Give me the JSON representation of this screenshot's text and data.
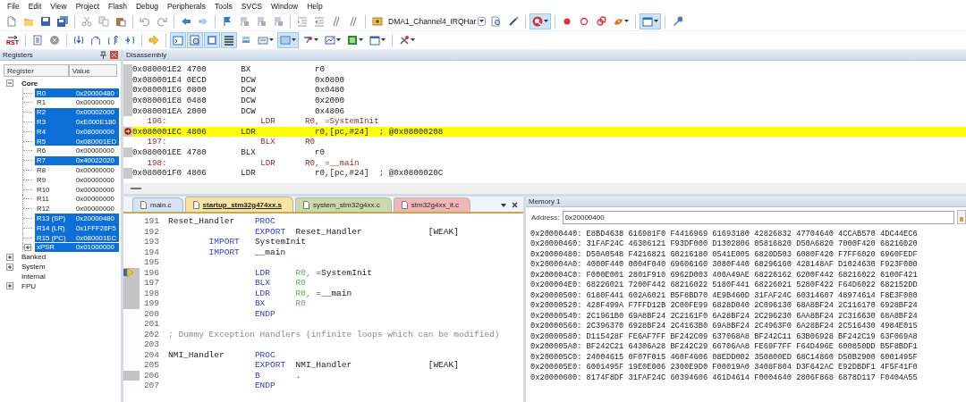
{
  "menu": [
    "File",
    "Edit",
    "View",
    "Project",
    "Flash",
    "Debug",
    "Peripherals",
    "Tools",
    "SVCS",
    "Window",
    "Help"
  ],
  "toolbar": {
    "target": "DMA1_Channel4_IRQHar",
    "debug_on": true,
    "window_layout_on": true
  },
  "debug_toolbar": {
    "reset_label": "RST",
    "view_buttons": [
      {
        "on": true
      },
      {
        "on": true
      },
      {
        "on": true
      },
      {
        "on": true
      },
      {
        "on": false
      },
      {
        "on": false
      },
      {
        "on": true
      },
      {
        "on": false
      },
      {
        "on": false
      },
      {
        "on": false
      },
      {
        "on": false
      }
    ]
  },
  "registers": {
    "title": "Registers",
    "columns": [
      "Register",
      "Value"
    ],
    "tree": [
      {
        "name": "Core",
        "expanded": true,
        "children": [
          {
            "name": "R0",
            "value": "0x20000480",
            "selected": true
          },
          {
            "name": "R1",
            "value": "0x00000000",
            "selected": false
          },
          {
            "name": "R2",
            "value": "0x00002000",
            "selected": true
          },
          {
            "name": "R3",
            "value": "0xE000E180",
            "selected": true
          },
          {
            "name": "R4",
            "value": "0x08000000",
            "selected": true
          },
          {
            "name": "R5",
            "value": "0x080001ED",
            "selected": true
          },
          {
            "name": "R6",
            "value": "0x00000000",
            "selected": false
          },
          {
            "name": "R7",
            "value": "0x40022020",
            "selected": true
          },
          {
            "name": "R8",
            "value": "0x00000000",
            "selected": false
          },
          {
            "name": "R9",
            "value": "0x00000000",
            "selected": false
          },
          {
            "name": "R10",
            "value": "0x00000000",
            "selected": false
          },
          {
            "name": "R11",
            "value": "0x00000000",
            "selected": false
          },
          {
            "name": "R12",
            "value": "0x00000000",
            "selected": false
          },
          {
            "name": "R13 (SP)",
            "value": "0x20000480",
            "selected": true
          },
          {
            "name": "R14 (LR)",
            "value": "0x1FFF26F5",
            "selected": true
          },
          {
            "name": "R15 (PC)",
            "value": "0x080001EC",
            "selected": true
          },
          {
            "name": "xPSR",
            "value": "0x01000000",
            "selected": true,
            "expanded": false
          }
        ]
      },
      {
        "name": "Banked",
        "expanded": false
      },
      {
        "name": "System",
        "expanded": false
      },
      {
        "name": "Internal"
      },
      {
        "name": "FPU",
        "expanded": false
      }
    ]
  },
  "disassembly": {
    "title": "Disassembly",
    "lines": [
      {
        "kind": "asm",
        "address": "0x080001E2",
        "opcode": "4700",
        "mnemonic": "BX",
        "operands": "r0",
        "current": false
      },
      {
        "kind": "asm",
        "address": "0x080001E4",
        "opcode": "0ECD",
        "mnemonic": "DCW",
        "operands": "0x0800",
        "current": false
      },
      {
        "kind": "asm",
        "address": "0x080001E6",
        "opcode": "0800",
        "mnemonic": "DCW",
        "operands": "0x0480",
        "current": false
      },
      {
        "kind": "asm",
        "address": "0x080001E8",
        "opcode": "0480",
        "mnemonic": "DCW",
        "operands": "0x2000",
        "current": false
      },
      {
        "kind": "asm",
        "address": "0x080001EA",
        "opcode": "2000",
        "mnemonic": "DCW",
        "operands": "0x4806",
        "current": false
      },
      {
        "kind": "src",
        "line": "196:",
        "mnemonic": "LDR",
        "operands": "R0, =SystemInit",
        "current": false
      },
      {
        "kind": "asm",
        "address": "0x080001EC",
        "opcode": "4806",
        "mnemonic": "LDR",
        "operands": "r0,[pc,#24]",
        "comment": "; @0x08000208",
        "current": true
      },
      {
        "kind": "src",
        "line": "197:",
        "mnemonic": "BLX",
        "operands": "R0",
        "current": false
      },
      {
        "kind": "asm",
        "address": "0x080001EE",
        "opcode": "4780",
        "mnemonic": "BLX",
        "operands": "r0",
        "current": false
      },
      {
        "kind": "src",
        "line": "198:",
        "mnemonic": "LDR",
        "operands": "R0, =__main",
        "current": false
      },
      {
        "kind": "asm",
        "address": "0x080001F0",
        "opcode": "4806",
        "mnemonic": "LDR",
        "operands": "r0,[pc,#24]",
        "comment": "; @0x0800020C",
        "current": false
      }
    ]
  },
  "editor": {
    "tabs": [
      {
        "label": "main.c",
        "selected": false,
        "color": "#d6e4f4"
      },
      {
        "label": "startup_stm32g474xx.s",
        "selected": true,
        "color": "#f7e4a2"
      },
      {
        "label": "system_stm32g4xx.c",
        "selected": false,
        "color": "#c9dbab"
      },
      {
        "label": "stm32g4xx_it.c",
        "selected": false,
        "color": "#f2b6b9"
      }
    ],
    "lines": [
      {
        "num": "191",
        "kind": "code",
        "label": "Reset_Handler",
        "op": "PROC",
        "current": false,
        "executable": false
      },
      {
        "num": "192",
        "kind": "code",
        "op": "EXPORT",
        "args": "Reset_Handler",
        "attr": "[WEAK]",
        "current": false,
        "executable": false
      },
      {
        "num": "193",
        "kind": "import",
        "op": "IMPORT",
        "args": "SystemInit",
        "current": false,
        "executable": false
      },
      {
        "num": "194",
        "kind": "import",
        "op": "IMPORT",
        "args": "__main",
        "current": false,
        "executable": false
      },
      {
        "num": "195",
        "kind": "blank",
        "current": false,
        "executable": false
      },
      {
        "num": "196",
        "kind": "code",
        "op": "LDR",
        "reg": "R0,",
        "args": "=SystemInit",
        "current": true,
        "executable": true
      },
      {
        "num": "197",
        "kind": "code",
        "op": "BLX",
        "reg": "R0",
        "current": false,
        "executable": true
      },
      {
        "num": "198",
        "kind": "code",
        "op": "LDR",
        "reg": "R0,",
        "args": "=__main",
        "current": false,
        "executable": true
      },
      {
        "num": "199",
        "kind": "code",
        "op": "BX",
        "reg": "R0",
        "current": false,
        "executable": true
      },
      {
        "num": "200",
        "kind": "code",
        "op": "ENDP",
        "current": false,
        "executable": false
      },
      {
        "num": "201",
        "kind": "blank",
        "current": false,
        "executable": false
      },
      {
        "num": "202",
        "kind": "comment",
        "text": "; Dummy Exception Handlers (infinite loops which can be modified)",
        "current": false,
        "executable": false
      },
      {
        "num": "203",
        "kind": "blank",
        "current": false,
        "executable": false
      },
      {
        "num": "204",
        "kind": "code",
        "label": "NMI_Handler",
        "op": "PROC",
        "current": false,
        "executable": false
      },
      {
        "num": "205",
        "kind": "code",
        "op": "EXPORT",
        "args": "NMI_Handler",
        "attr": "[WEAK]",
        "current": false,
        "executable": false
      },
      {
        "num": "206",
        "kind": "code",
        "op": "B",
        "args": ".",
        "current": false,
        "executable": true
      },
      {
        "num": "207",
        "kind": "code",
        "op": "ENDP",
        "current": false,
        "executable": false
      }
    ]
  },
  "memory": {
    "title": "Memory 1",
    "address_label": "Address:",
    "address": "0x20000400",
    "rows": [
      {
        "address": "0x20000440:",
        "words": [
          "E8BD4638",
          "616981F0",
          "F4416969",
          "61693180",
          "42826832",
          "47704640",
          "4CCAB570",
          "4DC44EC6"
        ]
      },
      {
        "address": "0x20000460:",
        "words": [
          "31FAF24C",
          "46306121",
          "F93DF000",
          "D1302806",
          "05816820",
          "D50A6820",
          "7000F420",
          "68216020"
        ]
      },
      {
        "address": "0x20000480:",
        "words": [
          "D50A0548",
          "F4216821",
          "60216180",
          "0541E005",
          "6820D503",
          "6080F420",
          "F7FF6020",
          "6960FEDF"
        ]
      },
      {
        "address": "0x200004A0:",
        "words": [
          "4000F440",
          "0004F040",
          "69606160",
          "3080F440",
          "68296160",
          "428148AF",
          "D1024630",
          "F923F000"
        ]
      },
      {
        "address": "0x200004C0:",
        "words": [
          "F000E001",
          "2801F910",
          "6962D003",
          "400A49AE",
          "68226162",
          "6200F442",
          "68216022",
          "6100F421"
        ]
      },
      {
        "address": "0x200004E0:",
        "words": [
          "68226021",
          "7200F442",
          "68216022",
          "5180F441",
          "68226021",
          "5280F422",
          "F64D6022",
          "682152DD"
        ]
      },
      {
        "address": "0x20000500:",
        "words": [
          "6180F441",
          "602A6021",
          "B5F8BD70",
          "4E9B460D",
          "31FAF24C",
          "60314607",
          "48974614",
          "F8E3F000"
        ]
      },
      {
        "address": "0x20000520:",
        "words": [
          "428F499A",
          "F7FFD12B",
          "2C00FE99",
          "6828D040",
          "2C096130",
          "68A8BF24",
          "2C116170",
          "6928BF24"
        ]
      },
      {
        "address": "0x20000540:",
        "words": [
          "2C1961B0",
          "69A8BF24",
          "2C2161F0",
          "6A28BF24",
          "2C296230",
          "6AA8BF24",
          "2C316630",
          "68A8BF24"
        ]
      },
      {
        "address": "0x20000560:",
        "words": [
          "2C396370",
          "6928BF24",
          "2C4163B0",
          "69A8BF24",
          "2C4963F0",
          "6A28BF24",
          "2C516430",
          "4984E015"
        ]
      },
      {
        "address": "0x20000580:",
        "words": [
          "D115428F",
          "FE6AF7FF",
          "BF242C09",
          "637068A8",
          "BF242C11",
          "63B06928",
          "BF242C19",
          "63F069A8"
        ]
      },
      {
        "address": "0x200005A0:",
        "words": [
          "BF242C21",
          "64306A28",
          "BF242C29",
          "66706AA8",
          "FE69F7FF",
          "F64D496E",
          "600850DD",
          "B5F8BDF1"
        ]
      },
      {
        "address": "0x200005C0:",
        "words": [
          "24004615",
          "0F07F015",
          "460F4606",
          "08EDD002",
          "350800ED",
          "68C14860",
          "D50B2900",
          "6001495F"
        ]
      },
      {
        "address": "0x200005E0:",
        "words": [
          "6001495F",
          "19E0E006",
          "2300E9D0",
          "F00019A0",
          "3408F804",
          "D3F642AC",
          "E92DBDF1",
          "4F5F41F0"
        ]
      },
      {
        "address": "0x20000600:",
        "words": [
          "8174F8DF",
          "31FAF24C",
          "60394606",
          "461D4614",
          "F0004640",
          "2806F868",
          "6878D117",
          "F0404A55"
        ]
      }
    ]
  }
}
